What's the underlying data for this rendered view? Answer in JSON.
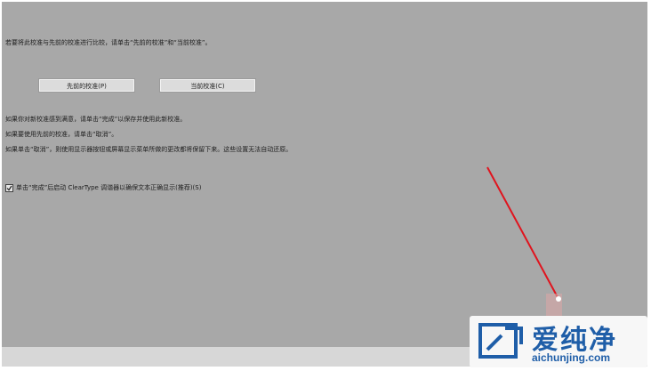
{
  "intro": "若要将此校准与先前的校准进行比较，请单击“先前的校准”和“当前校准”。",
  "buttons": {
    "previous": "先前的校准(P)",
    "current": "当前校准(C)"
  },
  "lines": {
    "satisfied": "如果你对新校准感到满意，请单击“完成”以保存并使用此新校准。",
    "use_previous": "如果要使用先前的校准，请单击“取消”。",
    "cancel_note": "如果单击“取消”，则使用显示器按钮或屏幕显示菜单所做的更改都将保留下来。这些设置无法自动还原。"
  },
  "checkbox": {
    "label": "单击“完成”后启动 ClearType 调谐器以确保文本正确显示(推荐)(S)",
    "checked": true,
    "mark": "☑"
  },
  "watermark": {
    "title": "爱纯净",
    "url": "aichunjing.com"
  },
  "colors": {
    "panel": "#a8a8a8",
    "laser": "#e0141e",
    "watermark_blue": "#1f5ea8"
  }
}
